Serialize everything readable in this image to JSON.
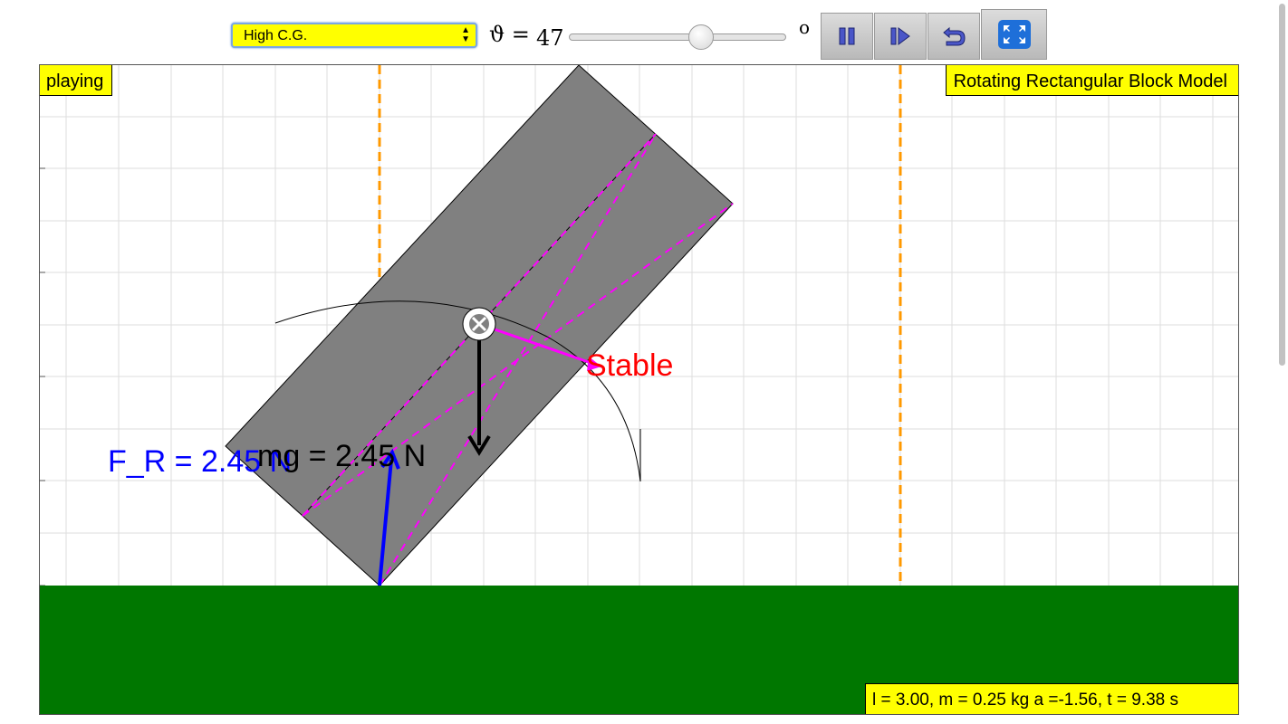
{
  "controls": {
    "preset_select": {
      "selected": "High C.G."
    },
    "theta_symbol": "ϑ =",
    "theta_value": "47",
    "theta_slider_fraction": 0.6,
    "degree_symbol": "o",
    "buttons": [
      {
        "name": "pause-button",
        "icon": "pause-icon"
      },
      {
        "name": "step-button",
        "icon": "step-forward-icon"
      },
      {
        "name": "reset-button",
        "icon": "reset-icon"
      },
      {
        "name": "fullscreen-button",
        "icon": "fullscreen-icon"
      }
    ]
  },
  "canvas": {
    "status": "playing",
    "title": "Rotating Rectangular Block Model",
    "labels": {
      "reaction_force": "F_R = 2.45 N",
      "weight": "mg = 2.45 N",
      "stability": "Stable"
    },
    "readout": "l = 3.00, m = 0.25 kg a =-1.56, t = 9.38 s"
  },
  "colors": {
    "badge": "#ffff00",
    "ground": "#007700",
    "block": "#808080",
    "guide_line": "#ff9900",
    "diagonal": "#ff00ff",
    "reaction_arrow": "#0000ff",
    "weight_arrow": "#000000",
    "stability_text": "#ff0000",
    "accent": "#1e6fd9"
  }
}
